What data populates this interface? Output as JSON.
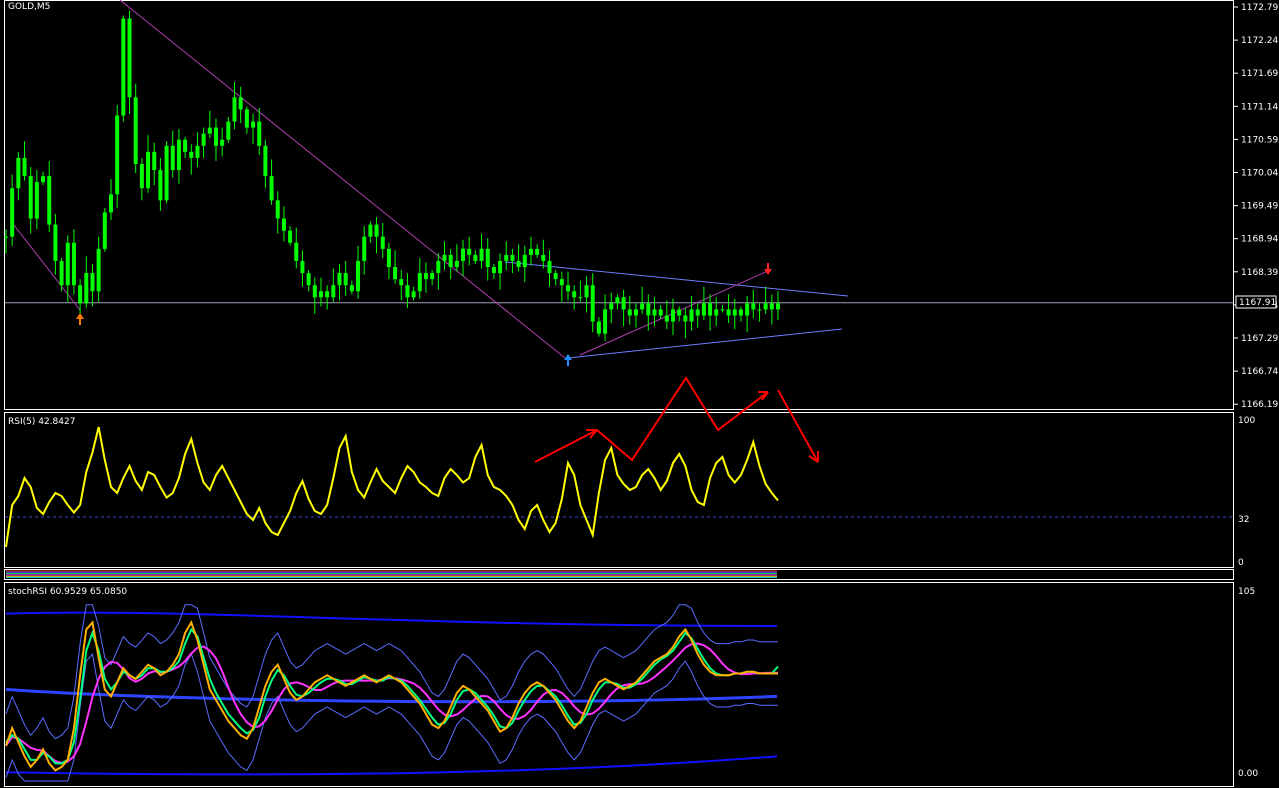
{
  "main_panel": {
    "title": "GOLD,M5",
    "price_ticks": [
      "1172.79",
      "1172.24",
      "1171.69",
      "1171.14",
      "1170.59",
      "1170.04",
      "1169.49",
      "1168.94",
      "1168.39",
      "1167.84",
      "1167.29",
      "1166.74",
      "1166.19"
    ],
    "current_price": "1167.91"
  },
  "rsi_panel": {
    "title": "RSI(5) 42.8427",
    "levels": [
      "100",
      "32",
      "0"
    ]
  },
  "stoch_panel": {
    "title": "stochRSI 60.9529 65.0850",
    "levels": [
      "105",
      "0.00"
    ]
  },
  "colors": {
    "background": "#000000",
    "grid_border": "#ffffff",
    "candle_up": "#00ff00",
    "rsi_line": "#ffff00",
    "stoch_main": "#ffb000",
    "stoch_signal": "#00ff80",
    "stoch_ma": "#ff33ff",
    "band_outer": "#1010ff",
    "band_inner": "#5a6cff",
    "trend_line": "#6f7cff",
    "annotation": "#ff0000",
    "price_line": "#9aa3b5"
  },
  "chart_data": {
    "type": "line",
    "series": [
      {
        "name": "GOLD,M5",
        "x": [
          0,
          10,
          20,
          30,
          40,
          50,
          60,
          70,
          80,
          90,
          100,
          110,
          120,
          130,
          140,
          150,
          160,
          170,
          180,
          190,
          200,
          210,
          220,
          230,
          240,
          250,
          260,
          270,
          280,
          290,
          300,
          310,
          320,
          330,
          340,
          350,
          360,
          370,
          380,
          390,
          400,
          410,
          420,
          430,
          440,
          450,
          460,
          470,
          480,
          490,
          500,
          510,
          520,
          530,
          540,
          550,
          560,
          570,
          580,
          590,
          600,
          610,
          620,
          630,
          640,
          650,
          660,
          670,
          680,
          690,
          700,
          710,
          720,
          730,
          740,
          750,
          760,
          770,
          780,
          790,
          800,
          810,
          820,
          830,
          840,
          850,
          860,
          870,
          880,
          890,
          900,
          910,
          920,
          930,
          940,
          950,
          960,
          970,
          980,
          990,
          1000,
          1010,
          1020,
          1030,
          1040,
          1050,
          1060,
          1070,
          1080,
          1090,
          1100,
          1110,
          1120,
          1130,
          1140,
          1150,
          1160,
          1170,
          1180,
          1190,
          1200,
          1210,
          1220,
          1230,
          1240,
          1250
        ],
        "y": [
          1169.0,
          1169.8,
          1170.3,
          1170.0,
          1169.3,
          1169.9,
          1170.0,
          1169.2,
          1168.6,
          1168.2,
          1168.9,
          1168.2,
          1167.9,
          1168.4,
          1168.1,
          1168.8,
          1169.4,
          1169.7,
          1171.0,
          1172.6,
          1171.3,
          1170.2,
          1169.8,
          1170.4,
          1170.1,
          1169.6,
          1170.5,
          1170.1,
          1170.6,
          1170.4,
          1170.3,
          1170.5,
          1170.7,
          1170.8,
          1170.5,
          1170.6,
          1170.9,
          1171.3,
          1171.1,
          1170.8,
          1170.9,
          1170.5,
          1170.0,
          1169.6,
          1169.3,
          1169.1,
          1168.9,
          1168.6,
          1168.4,
          1168.2,
          1168.0,
          1168.1,
          1168.0,
          1168.2,
          1168.4,
          1168.2,
          1168.1,
          1168.6,
          1169.0,
          1169.2,
          1169.0,
          1168.8,
          1168.5,
          1168.3,
          1168.2,
          1168.0,
          1168.1,
          1168.4,
          1168.3,
          1168.4,
          1168.6,
          1168.7,
          1168.5,
          1168.6,
          1168.8,
          1168.7,
          1168.6,
          1168.8,
          1168.5,
          1168.4,
          1168.6,
          1168.7,
          1168.6,
          1168.5,
          1168.7,
          1168.8,
          1168.7,
          1168.6,
          1168.4,
          1168.3,
          1168.2,
          1168.1,
          1168.0,
          1168.0,
          1168.2,
          1167.6,
          1167.4,
          1167.8,
          1167.9,
          1168.0,
          1167.8,
          1167.7,
          1167.8,
          1167.9,
          1167.7,
          1167.8,
          1167.7,
          1167.6,
          1167.8,
          1167.7,
          1167.6,
          1167.8,
          1167.7,
          1167.9,
          1167.7,
          1167.8,
          1167.8,
          1167.7,
          1167.8,
          1167.7,
          1167.9,
          1167.8,
          1167.8,
          1167.9,
          1167.8,
          1167.9
        ]
      },
      {
        "name": "RSI(5)",
        "x": [
          0,
          10,
          20,
          30,
          40,
          50,
          60,
          70,
          80,
          90,
          100,
          110,
          120,
          130,
          140,
          150,
          160,
          170,
          180,
          190,
          200,
          210,
          220,
          230,
          240,
          250,
          260,
          270,
          280,
          290,
          300,
          310,
          320,
          330,
          340,
          350,
          360,
          370,
          380,
          390,
          400,
          410,
          420,
          430,
          440,
          450,
          460,
          470,
          480,
          490,
          500,
          510,
          520,
          530,
          540,
          550,
          560,
          570,
          580,
          590,
          600,
          610,
          620,
          630,
          640,
          650,
          660,
          670,
          680,
          690,
          700,
          710,
          720,
          730,
          740,
          750,
          760,
          770,
          780,
          790,
          800,
          810,
          820,
          830,
          840,
          850,
          860,
          870,
          880,
          890,
          900,
          910,
          920,
          930,
          940,
          950,
          960,
          970,
          980,
          990,
          1000,
          1010,
          1020,
          1030,
          1040,
          1050,
          1060,
          1070,
          1080,
          1090,
          1100,
          1110,
          1120,
          1130,
          1140,
          1150,
          1160,
          1170,
          1180,
          1190,
          1200,
          1210,
          1220,
          1230,
          1240,
          1250
        ],
        "y": [
          12,
          40,
          46,
          58,
          52,
          38,
          34,
          42,
          48,
          46,
          40,
          35,
          40,
          62,
          75,
          92,
          70,
          52,
          48,
          58,
          66,
          56,
          50,
          62,
          60,
          52,
          45,
          48,
          58,
          74,
          84,
          68,
          55,
          50,
          60,
          66,
          58,
          50,
          42,
          34,
          30,
          38,
          28,
          22,
          20,
          28,
          36,
          48,
          56,
          44,
          36,
          34,
          40,
          58,
          78,
          86,
          62,
          50,
          45,
          55,
          64,
          56,
          52,
          48,
          58,
          66,
          62,
          55,
          52,
          48,
          46,
          58,
          64,
          60,
          55,
          58,
          72,
          80,
          60,
          52,
          50,
          46,
          40,
          30,
          24,
          36,
          40,
          30,
          22,
          28,
          44,
          68,
          60,
          40,
          30,
          20,
          48,
          70,
          78,
          60,
          54,
          50,
          52,
          60,
          64,
          58,
          50,
          56,
          68,
          74,
          66,
          50,
          42,
          40,
          58,
          68,
          72,
          60,
          55,
          60,
          70,
          82,
          66,
          54,
          48,
          43
        ]
      },
      {
        "name": "stochRSI",
        "x": [
          0,
          10,
          20,
          30,
          40,
          50,
          60,
          70,
          80,
          90,
          100,
          110,
          120,
          130,
          140,
          150,
          160,
          170,
          180,
          190,
          200,
          210,
          220,
          230,
          240,
          250,
          260,
          270,
          280,
          290,
          300,
          310,
          320,
          330,
          340,
          350,
          360,
          370,
          380,
          390,
          400,
          410,
          420,
          430,
          440,
          450,
          460,
          470,
          480,
          490,
          500,
          510,
          520,
          530,
          540,
          550,
          560,
          570,
          580,
          590,
          600,
          610,
          620,
          630,
          640,
          650,
          660,
          670,
          680,
          690,
          700,
          710,
          720,
          730,
          740,
          750,
          760,
          770,
          780,
          790,
          800,
          810,
          820,
          830,
          840,
          850,
          860,
          870,
          880,
          890,
          900,
          910,
          920,
          930,
          940,
          950,
          960,
          970,
          980,
          990,
          1000,
          1010,
          1020,
          1030,
          1040,
          1050,
          1060,
          1070,
          1080,
          1090,
          1100,
          1110,
          1120,
          1130,
          1140,
          1150,
          1160,
          1170,
          1180,
          1190,
          1200,
          1210,
          1220,
          1230,
          1240,
          1250
        ],
        "y": [
          20,
          30,
          22,
          14,
          8,
          12,
          18,
          10,
          6,
          8,
          12,
          30,
          60,
          86,
          90,
          70,
          52,
          48,
          56,
          64,
          60,
          58,
          62,
          66,
          64,
          60,
          62,
          66,
          72,
          84,
          90,
          80,
          66,
          52,
          46,
          40,
          34,
          30,
          26,
          24,
          30,
          42,
          54,
          62,
          66,
          58,
          50,
          46,
          48,
          52,
          56,
          58,
          60,
          58,
          56,
          54,
          56,
          58,
          60,
          58,
          56,
          58,
          60,
          58,
          56,
          52,
          48,
          44,
          38,
          32,
          30,
          34,
          42,
          50,
          54,
          52,
          48,
          44,
          40,
          34,
          28,
          30,
          36,
          44,
          50,
          54,
          56,
          54,
          50,
          46,
          40,
          34,
          30,
          34,
          42,
          50,
          56,
          58,
          56,
          54,
          52,
          54,
          56,
          60,
          64,
          68,
          70,
          72,
          76,
          82,
          86,
          80,
          72,
          66,
          62,
          60,
          60,
          60,
          61,
          61,
          62,
          62,
          61,
          61,
          61,
          61
        ]
      },
      {
        "name": "stochRSI signal",
        "x": [
          0,
          10,
          20,
          30,
          40,
          50,
          60,
          70,
          80,
          90,
          100,
          110,
          120,
          130,
          140,
          150,
          160,
          170,
          180,
          190,
          200,
          210,
          220,
          230,
          240,
          250,
          260,
          270,
          280,
          290,
          300,
          310,
          320,
          330,
          340,
          350,
          360,
          370,
          380,
          390,
          400,
          410,
          420,
          430,
          440,
          450,
          460,
          470,
          480,
          490,
          500,
          510,
          520,
          530,
          540,
          550,
          560,
          570,
          580,
          590,
          600,
          610,
          620,
          630,
          640,
          650,
          660,
          670,
          680,
          690,
          700,
          710,
          720,
          730,
          740,
          750,
          760,
          770,
          780,
          790,
          800,
          810,
          820,
          830,
          840,
          850,
          860,
          870,
          880,
          890,
          900,
          910,
          920,
          930,
          940,
          950,
          960,
          970,
          980,
          990,
          1000,
          1010,
          1020,
          1030,
          1040,
          1050,
          1060,
          1070,
          1080,
          1090,
          1100,
          1110,
          1120,
          1130,
          1140,
          1150,
          1160,
          1170,
          1180,
          1190,
          1200,
          1210,
          1220,
          1230,
          1240,
          1250
        ],
        "y": [
          22,
          26,
          24,
          18,
          12,
          12,
          16,
          14,
          10,
          10,
          12,
          22,
          46,
          74,
          84,
          74,
          58,
          52,
          56,
          62,
          60,
          58,
          60,
          64,
          64,
          62,
          62,
          64,
          68,
          78,
          86,
          82,
          70,
          58,
          50,
          44,
          38,
          34,
          30,
          27,
          29,
          36,
          48,
          57,
          63,
          60,
          54,
          49,
          48,
          50,
          53,
          56,
          58,
          58,
          57,
          55,
          55,
          57,
          59,
          58,
          57,
          57,
          59,
          58,
          57,
          54,
          50,
          46,
          41,
          36,
          32,
          33,
          38,
          46,
          51,
          52,
          50,
          46,
          42,
          37,
          31,
          30,
          33,
          40,
          46,
          51,
          54,
          54,
          51,
          48,
          43,
          37,
          32,
          33,
          38,
          46,
          52,
          56,
          56,
          55,
          53,
          53,
          55,
          58,
          62,
          66,
          69,
          71,
          74,
          79,
          84,
          81,
          75,
          69,
          64,
          61,
          60,
          60,
          61,
          61,
          62,
          62,
          61,
          61,
          61,
          65
        ]
      }
    ],
    "rsi_levels": [
      32
    ],
    "rsi_ylim": [
      0,
      100
    ],
    "stoch_ylim": [
      0,
      105
    ],
    "price_ylim": [
      1166.19,
      1172.79
    ]
  }
}
